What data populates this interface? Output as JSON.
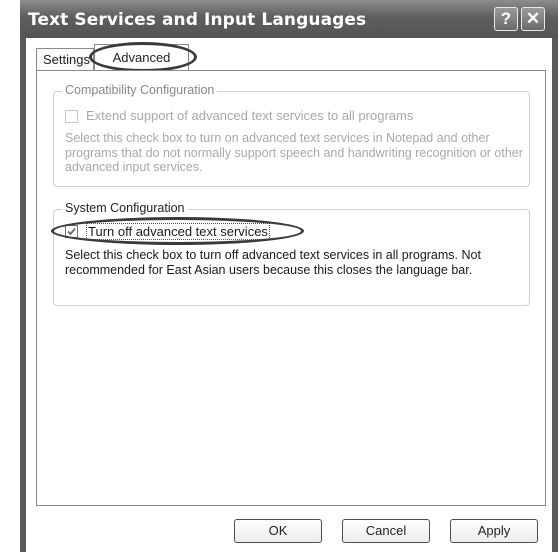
{
  "window": {
    "title": "Text Services and Input Languages",
    "help_glyph": "?",
    "close_glyph": "✕"
  },
  "tabs": [
    {
      "label": "Settings"
    },
    {
      "label": "Advanced"
    }
  ],
  "compat": {
    "legend": "Compatibility Configuration",
    "checkbox_label": "Extend support of advanced text services to all programs",
    "checked": false,
    "enabled": false,
    "description": "Select this check box to turn on advanced text services in Notepad and other programs that do not normally support speech and handwriting recognition or other advanced input services."
  },
  "system": {
    "legend": "System Configuration",
    "checkbox_label": "Turn off advanced text services",
    "checked": true,
    "enabled": true,
    "description": "Select this check box to turn off advanced text services in all programs. Not recommended for East Asian users because this closes the language bar."
  },
  "buttons": {
    "ok": "OK",
    "cancel": "Cancel",
    "apply": "Apply"
  }
}
